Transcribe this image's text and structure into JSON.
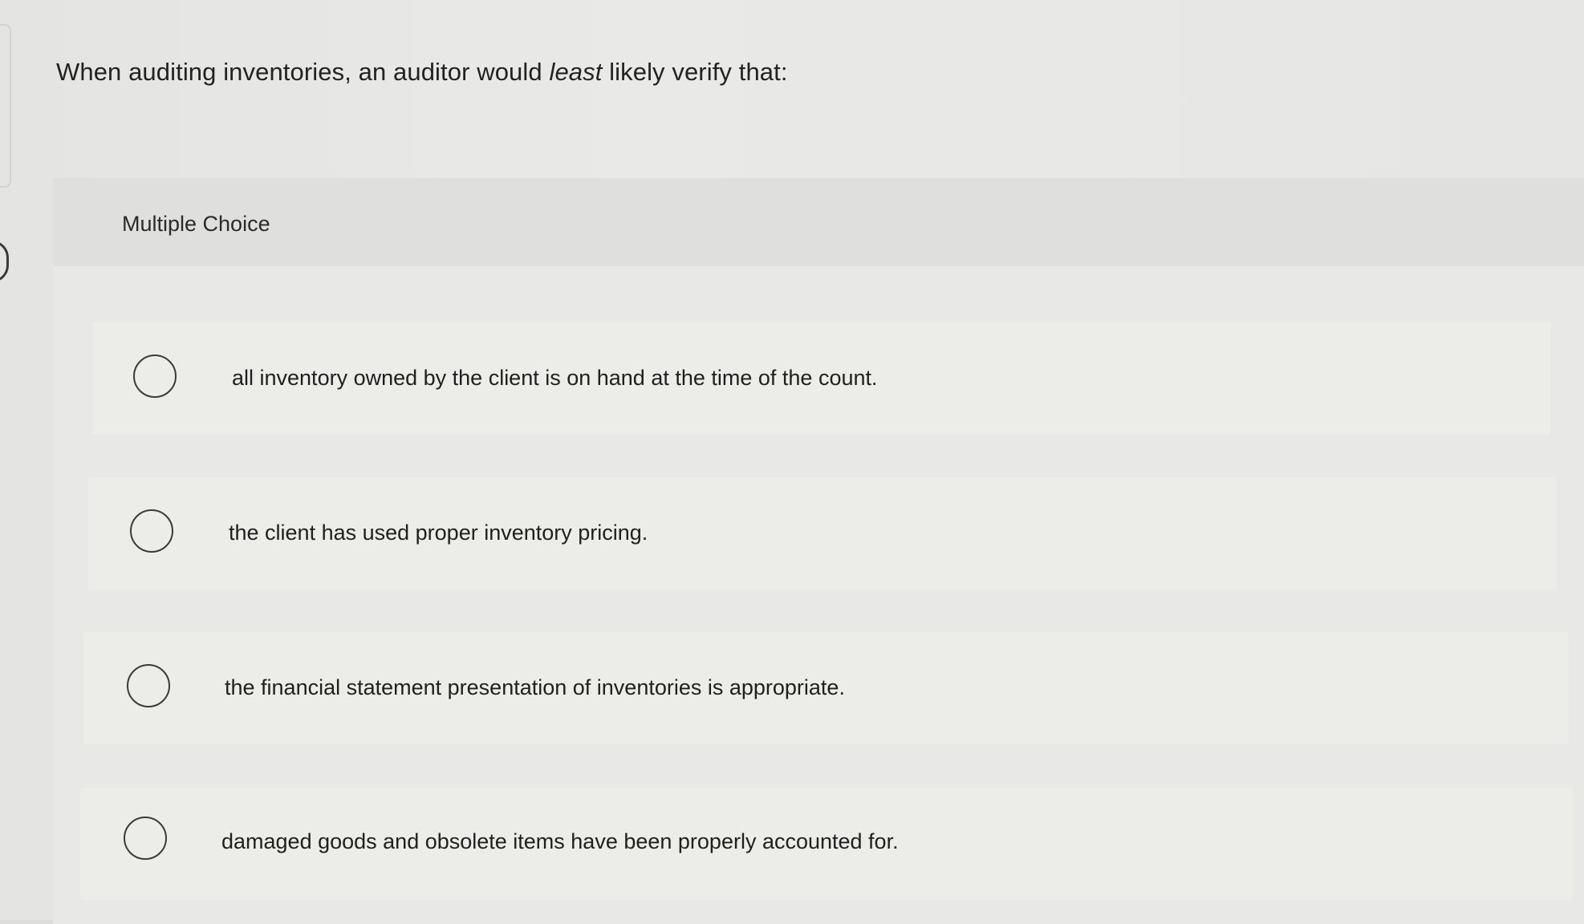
{
  "question": {
    "text_before": "When auditing inventories, an auditor would ",
    "emphasis": "least",
    "text_after": " likely verify that:"
  },
  "choice_type_label": "Multiple Choice",
  "options": [
    {
      "label": "all inventory owned by the client is on hand at the time of the count.",
      "selected": false
    },
    {
      "label": "the client has used proper inventory pricing.",
      "selected": false
    },
    {
      "label": "the financial statement presentation of inventories is appropriate.",
      "selected": false
    },
    {
      "label": "damaged goods and obsolete items have been properly accounted for.",
      "selected": false
    }
  ]
}
